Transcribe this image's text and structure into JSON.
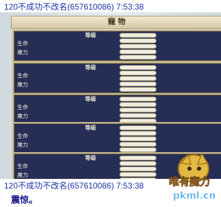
{
  "chat": {
    "header_top": "120不成功不改名(657610086) 7:53:38",
    "header_bottom": "120不成功不改名(657610086) 7:53:38",
    "message": "震惊。"
  },
  "game_window": {
    "title": "寵  物",
    "panels": [
      {
        "level_label": "等级",
        "hp_label": "生命",
        "mp_label": "魔力"
      },
      {
        "level_label": "等级",
        "hp_label": "生命",
        "mp_label": "魔力"
      },
      {
        "level_label": "等级",
        "hp_label": "生命",
        "mp_label": "魔力"
      },
      {
        "level_label": "等级",
        "hp_label": "生命",
        "mp_label": "魔力"
      },
      {
        "level_label": "等级",
        "hp_label": "生命",
        "mp_label": "魔力"
      }
    ]
  },
  "watermark": {
    "logo_text": "唯有魔力",
    "site_text": "pkml.cn"
  }
}
